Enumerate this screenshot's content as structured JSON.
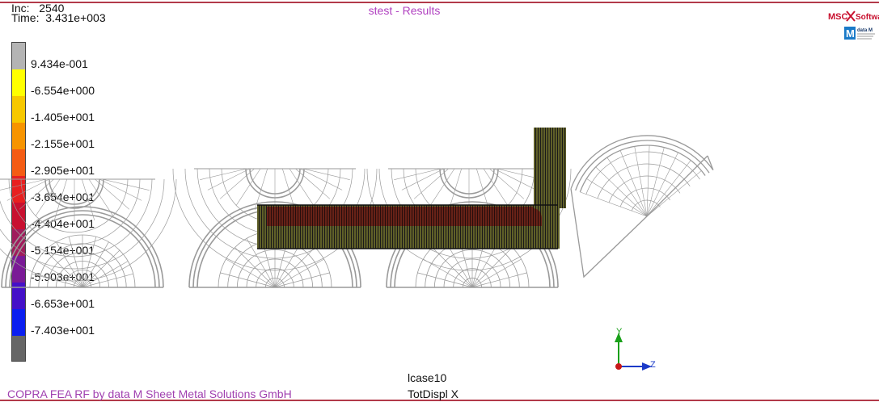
{
  "header": {
    "inc_label": "Inc:",
    "inc_value": "2540",
    "time_label": "Time:",
    "time_value": "3.431e+003",
    "title": "stest - Results"
  },
  "legend": {
    "entries": [
      {
        "label": "9.434e-001",
        "color": "#b4b4b4"
      },
      {
        "label": "-6.554e+000",
        "color": "#ffff00"
      },
      {
        "label": "-1.405e+001",
        "color": "#f7c800"
      },
      {
        "label": "-2.155e+001",
        "color": "#f79400"
      },
      {
        "label": "-2.905e+001",
        "color": "#f45c14"
      },
      {
        "label": "-3.654e+001",
        "color": "#e82020"
      },
      {
        "label": "-4.404e+001",
        "color": "#c81030"
      },
      {
        "label": "-5.154e+001",
        "color": "#a01c5c"
      },
      {
        "label": "-5.903e+001",
        "color": "#7a1a96"
      },
      {
        "label": "-6.653e+001",
        "color": "#4410c8"
      },
      {
        "label": "-7.403e+001",
        "color": "#0a1ef0"
      }
    ],
    "bottom_color": "#666666"
  },
  "logo": {
    "brand_text": "MSC",
    "brand_suffix": "Softwa",
    "sub_text": "data M"
  },
  "footer": {
    "load_case": "lcase10",
    "quantity": "TotDispl X",
    "credit": "COPRA FEA RF by data M Sheet Metal Solutions GmbH"
  },
  "triad": {
    "y_label": "Y",
    "z_label": "Z"
  }
}
